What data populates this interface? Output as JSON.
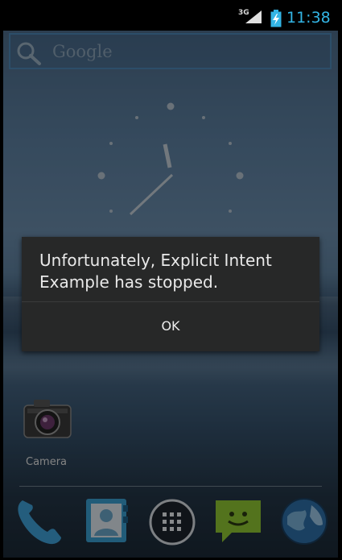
{
  "status_bar": {
    "network": "3G",
    "time": "11:38",
    "accent": "#33b5e5"
  },
  "search": {
    "label": "Google",
    "icon": "search-icon"
  },
  "dialog": {
    "message": "Unfortunately, Explicit Intent Example has stopped.",
    "ok_label": "OK"
  },
  "home": {
    "shortcuts": [
      {
        "label": "Camera",
        "icon": "camera-icon"
      }
    ],
    "dock": [
      {
        "icon": "phone-icon"
      },
      {
        "icon": "contacts-icon"
      },
      {
        "icon": "all-apps-icon"
      },
      {
        "icon": "messaging-icon"
      },
      {
        "icon": "browser-icon"
      }
    ]
  }
}
